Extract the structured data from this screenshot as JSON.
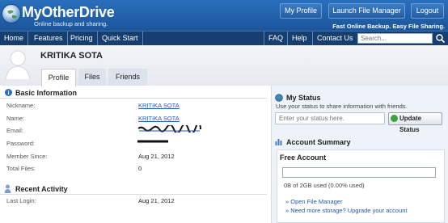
{
  "header": {
    "logo_text": "MyOtherDrive",
    "logo_tagline": "Online backup and sharing.",
    "buttons": {
      "profile": "My Profile",
      "file_manager": "Launch File Manager",
      "logout": "Logout"
    },
    "tagline": "Fast Online Backup. Easy File Sharing."
  },
  "nav": {
    "left": [
      "Home",
      "Features",
      "Pricing",
      "Quick Start"
    ],
    "right": [
      "FAQ",
      "Help",
      "Contact Us"
    ],
    "search_placeholder": "Search..."
  },
  "profile": {
    "name": "KRITIKA SOTA",
    "tabs": [
      "Profile",
      "Files",
      "Friends"
    ],
    "active_tab": "Profile"
  },
  "basic_info": {
    "title": "Basic Information",
    "fields": [
      {
        "label": "Nickname:",
        "value": "KRITIKA SOTA"
      },
      {
        "label": "Name:",
        "value": "KRITIKA SOTA"
      },
      {
        "label": "Email:",
        "value": ""
      },
      {
        "label": "Password:",
        "value": ""
      },
      {
        "label": "Member Since:",
        "value": "Aug 21, 2012"
      },
      {
        "label": "Total Files:",
        "value": "0"
      }
    ]
  },
  "recent_activity": {
    "title": "Recent Activity",
    "fields": [
      {
        "label": "Last Login:",
        "value": "Aug 21, 2012"
      }
    ]
  },
  "my_status": {
    "title": "My Status",
    "description": "Use your status to share information with friends.",
    "input_placeholder": "Enter your status here.",
    "update_button": "Update Status"
  },
  "account_summary": {
    "title": "Account Summary",
    "plan": "Free Account",
    "usage_fraction": 0.0,
    "usage_text": "0B of 2GB used (0.00% used)",
    "links": [
      "» Open File Manager",
      "» Need more storage? Upgrade your account"
    ]
  },
  "colors": {
    "header_blue": "#1f5fa6",
    "nav_dark": "#163f6f",
    "link_blue": "#2456b4"
  }
}
